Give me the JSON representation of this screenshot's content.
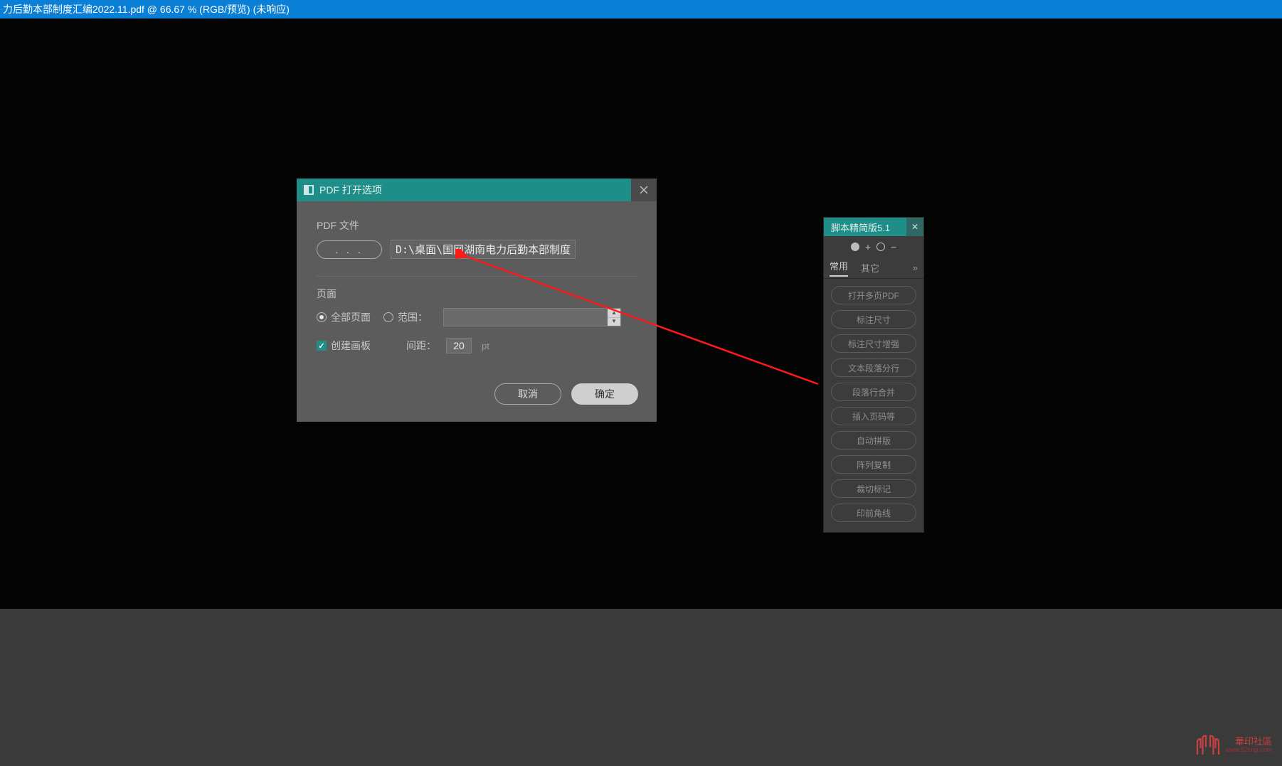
{
  "titlebar": "力后勤本部制度汇编2022.11.pdf @ 66.67 % (RGB/预览)  (未响应)",
  "dialog": {
    "title": "PDF 打开选项",
    "file_section_label": "PDF 文件",
    "browse_label": ". . .",
    "file_path": "D:\\桌面\\国网湖南电力后勤本部制度",
    "pages_section_label": "页面",
    "radio_all_label": "全部页面",
    "radio_range_label": "范围：",
    "range_value": "",
    "artboard_label": "创建画板",
    "gap_label": "间距：",
    "gap_value": "20",
    "gap_unit": "pt",
    "cancel_label": "取消",
    "ok_label": "确定"
  },
  "panel": {
    "title": "脚本精简版5.1",
    "plus": "+",
    "minus": "−",
    "tab_active": "常用",
    "tab_other": "其它",
    "more": "»",
    "items": [
      "打开多页PDF",
      "标注尺寸",
      "标注尺寸增强",
      "文本段落分行",
      "段落行合并",
      "插入页码等",
      "自动拼版",
      "阵列复制",
      "裁切标记",
      "印前角线"
    ]
  },
  "watermark": {
    "main": "華印社區",
    "sub": "www.52cnp.com"
  }
}
